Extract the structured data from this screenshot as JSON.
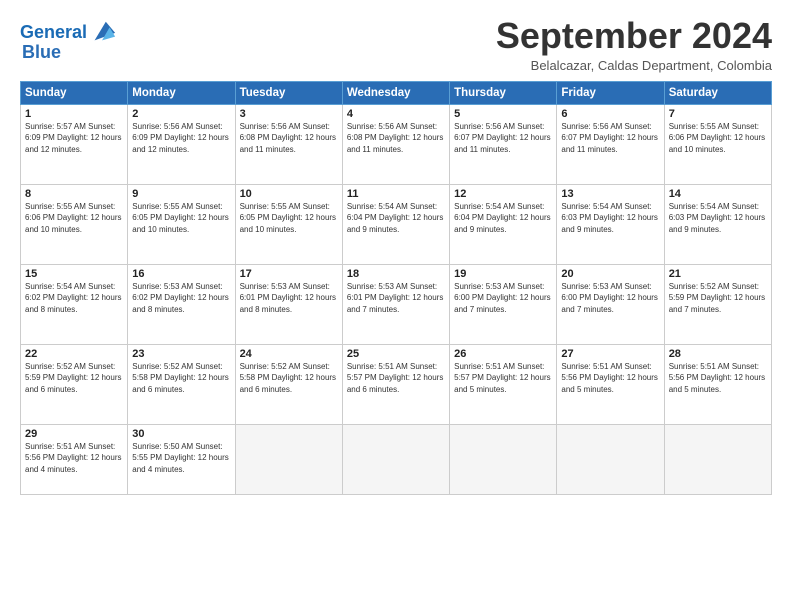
{
  "header": {
    "logo_line1": "General",
    "logo_line2": "Blue",
    "month_title": "September 2024",
    "subtitle": "Belalcazar, Caldas Department, Colombia"
  },
  "weekdays": [
    "Sunday",
    "Monday",
    "Tuesday",
    "Wednesday",
    "Thursday",
    "Friday",
    "Saturday"
  ],
  "weeks": [
    [
      {
        "day": "1",
        "info": "Sunrise: 5:57 AM\nSunset: 6:09 PM\nDaylight: 12 hours\nand 12 minutes."
      },
      {
        "day": "2",
        "info": "Sunrise: 5:56 AM\nSunset: 6:09 PM\nDaylight: 12 hours\nand 12 minutes."
      },
      {
        "day": "3",
        "info": "Sunrise: 5:56 AM\nSunset: 6:08 PM\nDaylight: 12 hours\nand 11 minutes."
      },
      {
        "day": "4",
        "info": "Sunrise: 5:56 AM\nSunset: 6:08 PM\nDaylight: 12 hours\nand 11 minutes."
      },
      {
        "day": "5",
        "info": "Sunrise: 5:56 AM\nSunset: 6:07 PM\nDaylight: 12 hours\nand 11 minutes."
      },
      {
        "day": "6",
        "info": "Sunrise: 5:56 AM\nSunset: 6:07 PM\nDaylight: 12 hours\nand 11 minutes."
      },
      {
        "day": "7",
        "info": "Sunrise: 5:55 AM\nSunset: 6:06 PM\nDaylight: 12 hours\nand 10 minutes."
      }
    ],
    [
      {
        "day": "8",
        "info": "Sunrise: 5:55 AM\nSunset: 6:06 PM\nDaylight: 12 hours\nand 10 minutes."
      },
      {
        "day": "9",
        "info": "Sunrise: 5:55 AM\nSunset: 6:05 PM\nDaylight: 12 hours\nand 10 minutes."
      },
      {
        "day": "10",
        "info": "Sunrise: 5:55 AM\nSunset: 6:05 PM\nDaylight: 12 hours\nand 10 minutes."
      },
      {
        "day": "11",
        "info": "Sunrise: 5:54 AM\nSunset: 6:04 PM\nDaylight: 12 hours\nand 9 minutes."
      },
      {
        "day": "12",
        "info": "Sunrise: 5:54 AM\nSunset: 6:04 PM\nDaylight: 12 hours\nand 9 minutes."
      },
      {
        "day": "13",
        "info": "Sunrise: 5:54 AM\nSunset: 6:03 PM\nDaylight: 12 hours\nand 9 minutes."
      },
      {
        "day": "14",
        "info": "Sunrise: 5:54 AM\nSunset: 6:03 PM\nDaylight: 12 hours\nand 9 minutes."
      }
    ],
    [
      {
        "day": "15",
        "info": "Sunrise: 5:54 AM\nSunset: 6:02 PM\nDaylight: 12 hours\nand 8 minutes."
      },
      {
        "day": "16",
        "info": "Sunrise: 5:53 AM\nSunset: 6:02 PM\nDaylight: 12 hours\nand 8 minutes."
      },
      {
        "day": "17",
        "info": "Sunrise: 5:53 AM\nSunset: 6:01 PM\nDaylight: 12 hours\nand 8 minutes."
      },
      {
        "day": "18",
        "info": "Sunrise: 5:53 AM\nSunset: 6:01 PM\nDaylight: 12 hours\nand 7 minutes."
      },
      {
        "day": "19",
        "info": "Sunrise: 5:53 AM\nSunset: 6:00 PM\nDaylight: 12 hours\nand 7 minutes."
      },
      {
        "day": "20",
        "info": "Sunrise: 5:53 AM\nSunset: 6:00 PM\nDaylight: 12 hours\nand 7 minutes."
      },
      {
        "day": "21",
        "info": "Sunrise: 5:52 AM\nSunset: 5:59 PM\nDaylight: 12 hours\nand 7 minutes."
      }
    ],
    [
      {
        "day": "22",
        "info": "Sunrise: 5:52 AM\nSunset: 5:59 PM\nDaylight: 12 hours\nand 6 minutes."
      },
      {
        "day": "23",
        "info": "Sunrise: 5:52 AM\nSunset: 5:58 PM\nDaylight: 12 hours\nand 6 minutes."
      },
      {
        "day": "24",
        "info": "Sunrise: 5:52 AM\nSunset: 5:58 PM\nDaylight: 12 hours\nand 6 minutes."
      },
      {
        "day": "25",
        "info": "Sunrise: 5:51 AM\nSunset: 5:57 PM\nDaylight: 12 hours\nand 6 minutes."
      },
      {
        "day": "26",
        "info": "Sunrise: 5:51 AM\nSunset: 5:57 PM\nDaylight: 12 hours\nand 5 minutes."
      },
      {
        "day": "27",
        "info": "Sunrise: 5:51 AM\nSunset: 5:56 PM\nDaylight: 12 hours\nand 5 minutes."
      },
      {
        "day": "28",
        "info": "Sunrise: 5:51 AM\nSunset: 5:56 PM\nDaylight: 12 hours\nand 5 minutes."
      }
    ],
    [
      {
        "day": "29",
        "info": "Sunrise: 5:51 AM\nSunset: 5:56 PM\nDaylight: 12 hours\nand 4 minutes."
      },
      {
        "day": "30",
        "info": "Sunrise: 5:50 AM\nSunset: 5:55 PM\nDaylight: 12 hours\nand 4 minutes."
      },
      {
        "day": "",
        "info": ""
      },
      {
        "day": "",
        "info": ""
      },
      {
        "day": "",
        "info": ""
      },
      {
        "day": "",
        "info": ""
      },
      {
        "day": "",
        "info": ""
      }
    ]
  ]
}
